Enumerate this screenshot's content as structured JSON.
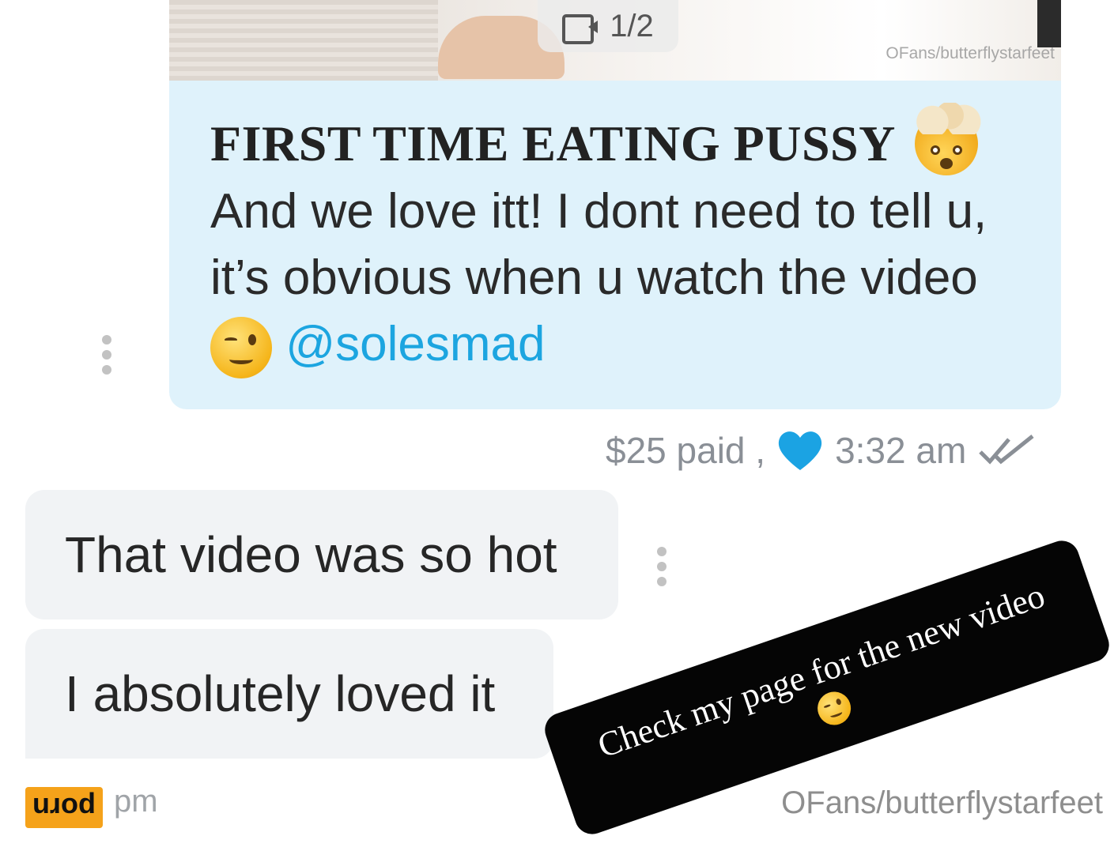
{
  "media": {
    "counter": "1/2",
    "camera_icon": "video-camera-icon",
    "watermark": "OFans/butterflystarfeet"
  },
  "outgoing_message": {
    "title": "FIRST TIME EATING PUSSY",
    "title_emoji": "exploding-head-emoji",
    "body": "And we love itt! I dont need to tell u, it’s obvious when u watch the video",
    "body_emoji": "winking-face-emoji",
    "mention": "@solesmad",
    "bubble_color": "#dff2fb",
    "mention_color": "#1ca5e0"
  },
  "meta": {
    "price": "$25 paid ,",
    "heart_color": "#1ba3e3",
    "time": "3:32 am",
    "status_icon": "double-check-icon"
  },
  "incoming_messages": [
    {
      "text": "That video was so hot"
    },
    {
      "text": "I absolutely loved it"
    }
  ],
  "incoming_time_partial": "pm",
  "sticker": {
    "text": "Check my page for the new video",
    "emoji": "winking-face-emoji"
  },
  "logo": {
    "text": "porn",
    "color": "#f5a21a"
  },
  "bottom_watermark": "OFans/butterflystarfeet"
}
